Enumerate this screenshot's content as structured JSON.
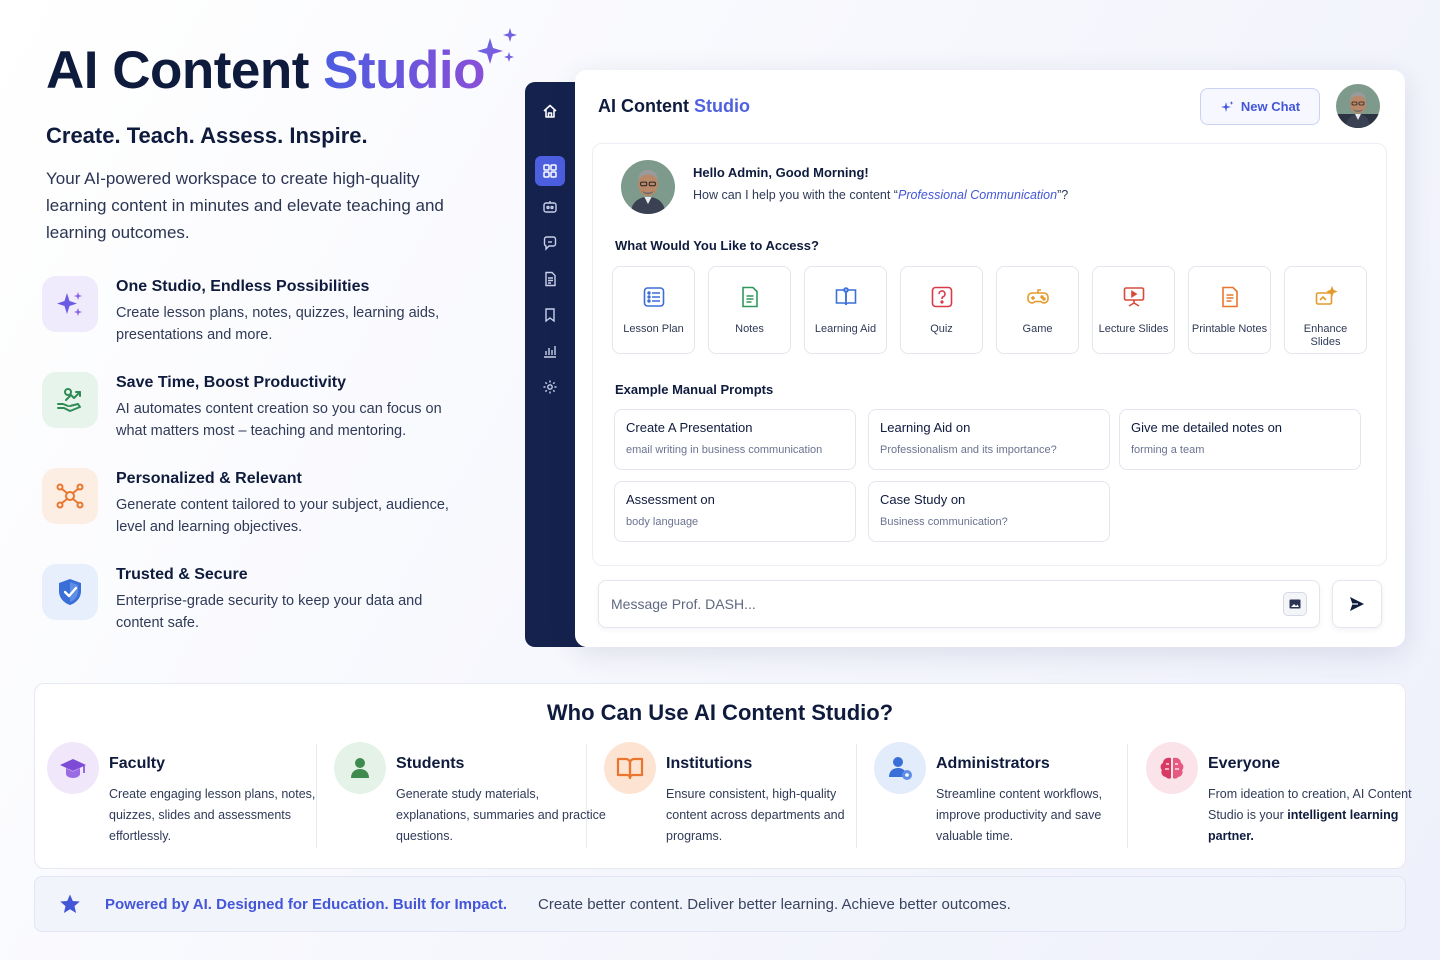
{
  "hero": {
    "title_main": "AI Content",
    "title_accent": "Studio",
    "tagline": "Create. Teach. Assess. Inspire.",
    "description": "Your AI-powered workspace to create high-quality learning content in minutes and elevate teaching and learning outcomes."
  },
  "features": [
    {
      "title": "One Studio, Endless Possibilities",
      "text": "Create lesson plans, notes, quizzes, learning aids, presentations and more.",
      "icon": "sparkles-icon"
    },
    {
      "title": "Save Time, Boost Productivity",
      "text": "AI automates content creation so you can focus on what matters most – teaching and mentoring.",
      "icon": "growth-hand-icon"
    },
    {
      "title": "Personalized & Relevant",
      "text": "Generate content tailored to your subject, audience, level and learning objectives.",
      "icon": "target-network-icon"
    },
    {
      "title": "Trusted & Secure",
      "text": "Enterprise-grade security to keep your data and content safe.",
      "icon": "shield-icon"
    }
  ],
  "app": {
    "title_main": "AI Content",
    "title_accent": "Studio",
    "new_chat_label": "New Chat",
    "greeting_title": "Hello Admin, Good Morning!",
    "greeting_prefix": "How can I help you with the content “",
    "greeting_topic": "Professional Communication",
    "greeting_suffix": "”?",
    "access_label": "What Would You Like to Access?",
    "tiles": [
      {
        "label": "Lesson Plan",
        "icon": "list-icon"
      },
      {
        "label": "Notes",
        "icon": "notes-icon"
      },
      {
        "label": "Learning Aid",
        "icon": "book-icon"
      },
      {
        "label": "Quiz",
        "icon": "question-icon"
      },
      {
        "label": "Game",
        "icon": "gamepad-icon"
      },
      {
        "label": "Lecture Slides",
        "icon": "presentation-icon"
      },
      {
        "label": "Printable Notes",
        "icon": "printable-doc-icon"
      },
      {
        "label": "Enhance Slides",
        "icon": "magic-slides-icon"
      }
    ],
    "prompts_label": "Example Manual Prompts",
    "prompts": [
      {
        "title": "Create A Presentation",
        "sub": "email writing in business communication"
      },
      {
        "title": "Learning Aid on",
        "sub": "Professionalism and its importance?"
      },
      {
        "title": "Give me detailed notes on",
        "sub": "forming a team"
      },
      {
        "title": "Assessment on",
        "sub": "body language"
      },
      {
        "title": "Case Study on",
        "sub": "Business communication?"
      }
    ],
    "message_placeholder": "Message Prof. DASH..."
  },
  "who": {
    "title": "Who Can Use AI Content Studio?",
    "audiences": [
      {
        "name": "Faculty",
        "text": "Create engaging lesson plans, notes, quizzes, slides and assessments effortlessly.",
        "icon": "graduation-cap-icon"
      },
      {
        "name": "Students",
        "text": "Generate study materials, explanations, summaries and practice questions.",
        "icon": "student-icon"
      },
      {
        "name": "Institutions",
        "text": "Ensure consistent, high-quality content across departments and programs.",
        "icon": "open-book-icon"
      },
      {
        "name": "Administrators",
        "text": "Streamline content workflows, improve productivity and save valuable time.",
        "icon": "admin-user-icon"
      },
      {
        "name": "Everyone",
        "text_plain": "From ideation to creation, AI Content Studio is your",
        "text_bold": "intelligent learning partner.",
        "icon": "brain-icon"
      }
    ]
  },
  "banner": {
    "strong": "Powered by AI. Designed for Education. Built for Impact.",
    "text": "Create better content. Deliver better learning. Achieve better outcomes."
  },
  "colors": {
    "navy": "#0f1b3d",
    "accent": "#4c5fe0",
    "sidebar": "#14224d"
  }
}
